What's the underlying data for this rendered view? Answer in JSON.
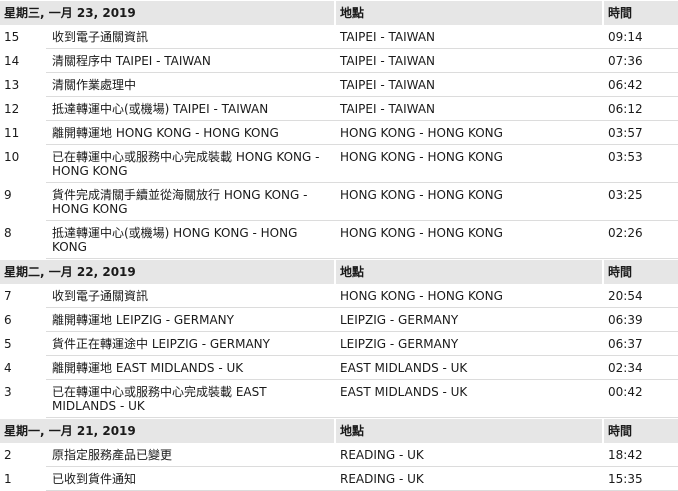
{
  "columns": {
    "location": "地點",
    "time": "時間"
  },
  "days": [
    {
      "date": "星期三, 一月 23, 2019",
      "events": [
        {
          "num": "15",
          "desc": "收到電子通關資訊",
          "loc": "TAIPEI - TAIWAN",
          "time": "09:14"
        },
        {
          "num": "14",
          "desc": "清關程序中 TAIPEI - TAIWAN",
          "loc": "TAIPEI - TAIWAN",
          "time": "07:36"
        },
        {
          "num": "13",
          "desc": "清關作業處理中",
          "loc": "TAIPEI - TAIWAN",
          "time": "06:42"
        },
        {
          "num": "12",
          "desc": "抵達轉運中心(或機場) TAIPEI - TAIWAN",
          "loc": "TAIPEI - TAIWAN",
          "time": "06:12"
        },
        {
          "num": "11",
          "desc": "離開轉運地 HONG KONG - HONG KONG",
          "loc": "HONG KONG - HONG KONG",
          "time": "03:57"
        },
        {
          "num": "10",
          "desc": "已在轉運中心或服務中心完成裝載 HONG KONG - HONG KONG",
          "loc": "HONG KONG - HONG KONG",
          "time": "03:53"
        },
        {
          "num": "9",
          "desc": "貨件完成清關手續並從海關放行 HONG KONG - HONG KONG",
          "loc": "HONG KONG - HONG KONG",
          "time": "03:25"
        },
        {
          "num": "8",
          "desc": "抵達轉運中心(或機場) HONG KONG - HONG KONG",
          "loc": "HONG KONG - HONG KONG",
          "time": "02:26"
        }
      ]
    },
    {
      "date": "星期二, 一月 22, 2019",
      "events": [
        {
          "num": "7",
          "desc": "收到電子通關資訊",
          "loc": "HONG KONG - HONG KONG",
          "time": "20:54"
        },
        {
          "num": "6",
          "desc": "離開轉運地 LEIPZIG - GERMANY",
          "loc": "LEIPZIG - GERMANY",
          "time": "06:39"
        },
        {
          "num": "5",
          "desc": "貨件正在轉運途中 LEIPZIG - GERMANY",
          "loc": "LEIPZIG - GERMANY",
          "time": "06:37"
        },
        {
          "num": "4",
          "desc": "離開轉運地 EAST MIDLANDS - UK",
          "loc": "EAST MIDLANDS - UK",
          "time": "02:34"
        },
        {
          "num": "3",
          "desc": "已在轉運中心或服務中心完成裝載 EAST MIDLANDS - UK",
          "loc": "EAST MIDLANDS - UK",
          "time": "00:42"
        }
      ]
    },
    {
      "date": "星期一, 一月 21, 2019",
      "events": [
        {
          "num": "2",
          "desc": "原指定服務產品已變更",
          "loc": "READING - UK",
          "time": "18:42"
        },
        {
          "num": "1",
          "desc": "已收到貨件通知",
          "loc": "READING - UK",
          "time": "15:35"
        }
      ]
    }
  ]
}
